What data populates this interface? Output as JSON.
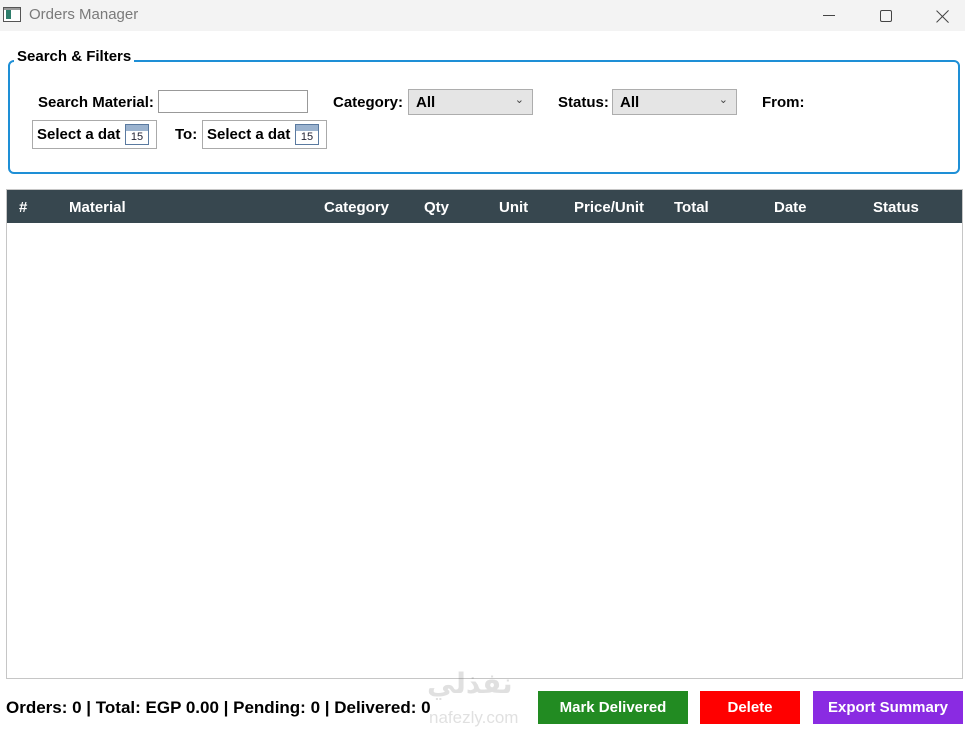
{
  "window": {
    "title": "Orders Manager"
  },
  "filters": {
    "group_label": "Search & Filters",
    "search_label": "Search Material:",
    "search_value": "",
    "category_label": "Category:",
    "category_value": "All",
    "status_label": "Status:",
    "status_value": "All",
    "from_label": "From:",
    "from_date_text": "Select a dat",
    "to_label": "To:",
    "to_date_text": "Select a dat",
    "calendar_day": "15"
  },
  "table": {
    "columns": [
      "#",
      "Material",
      "Category",
      "Qty",
      "Unit",
      "Price/Unit",
      "Total",
      "Date",
      "Status"
    ],
    "rows": []
  },
  "footer": {
    "summary": "Orders: 0 | Total: EGP 0.00 | Pending: 0 | Delivered: 0",
    "mark_delivered_label": "Mark Delivered",
    "delete_label": "Delete",
    "export_label": "Export Summary"
  },
  "watermark": {
    "arabic": "نفذلي",
    "latin": "nafezly.com"
  },
  "colors": {
    "header_bg": "#37474f",
    "group_border": "#1e8fd6",
    "mark_delivered": "#228b22",
    "delete": "#ff0000",
    "export": "#8a2be2"
  }
}
